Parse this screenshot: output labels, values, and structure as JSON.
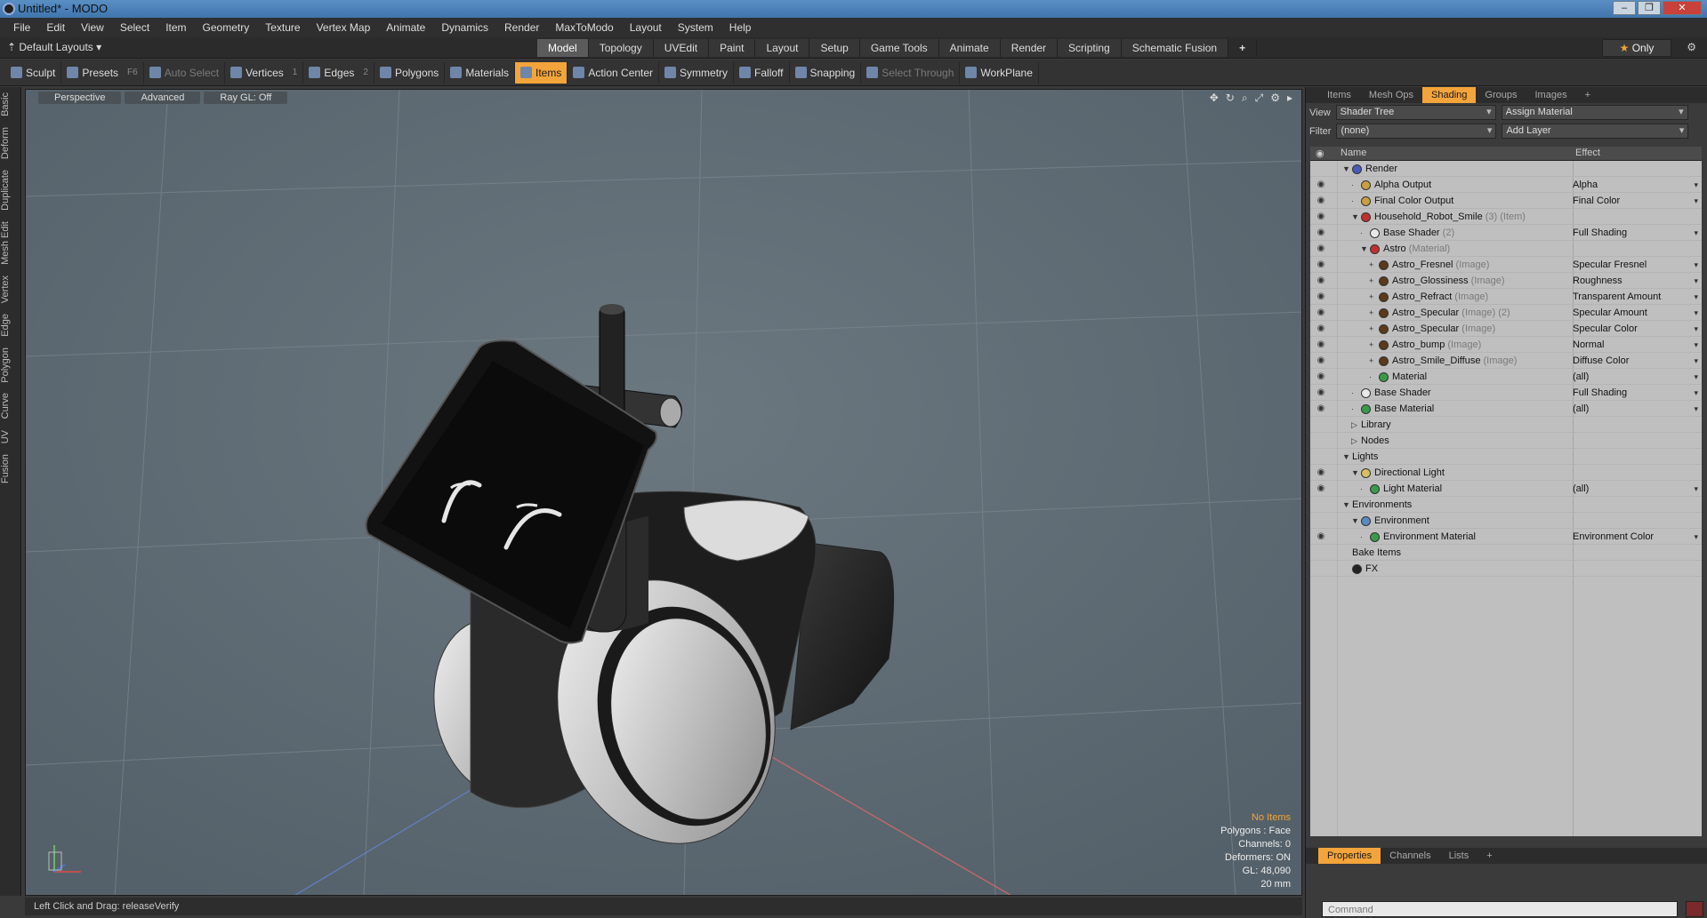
{
  "window": {
    "title": "Untitled* - MODO",
    "controls": [
      "–",
      "❐",
      "✕"
    ]
  },
  "menu": [
    "File",
    "Edit",
    "View",
    "Select",
    "Item",
    "Geometry",
    "Texture",
    "Vertex Map",
    "Animate",
    "Dynamics",
    "Render",
    "MaxToModo",
    "Layout",
    "System",
    "Help"
  ],
  "layout_selector": "Default Layouts",
  "mode_tabs": [
    {
      "label": "Model",
      "active": true
    },
    {
      "label": "Topology"
    },
    {
      "label": "UVEdit"
    },
    {
      "label": "Paint"
    },
    {
      "label": "Layout"
    },
    {
      "label": "Setup"
    },
    {
      "label": "Game Tools"
    },
    {
      "label": "Animate"
    },
    {
      "label": "Render"
    },
    {
      "label": "Scripting"
    },
    {
      "label": "Schematic Fusion"
    }
  ],
  "only_label": "Only",
  "toolbar": [
    {
      "label": "Sculpt",
      "icon": "brush-icon"
    },
    {
      "label": "Presets",
      "key": "F6",
      "icon": "presets-icon"
    },
    {
      "label": "Auto Select",
      "dim": true,
      "icon": "shield-icon"
    },
    {
      "label": "Vertices",
      "key": "1",
      "icon": "vertices-icon"
    },
    {
      "label": "Edges",
      "key": "2",
      "icon": "edges-icon"
    },
    {
      "label": "Polygons",
      "icon": "polygons-icon"
    },
    {
      "label": "Materials",
      "icon": "materials-icon"
    },
    {
      "label": "Items",
      "active": true,
      "icon": "items-icon"
    },
    {
      "label": "Action Center",
      "icon": "action-center-icon"
    },
    {
      "label": "Symmetry",
      "icon": "symmetry-icon"
    },
    {
      "label": "Falloff",
      "icon": "falloff-icon"
    },
    {
      "label": "Snapping",
      "icon": "snapping-icon"
    },
    {
      "label": "Select Through",
      "dim": true,
      "icon": "select-through-icon"
    },
    {
      "label": "WorkPlane",
      "icon": "workplane-icon"
    }
  ],
  "left_tabs": [
    "Basic",
    "Deform",
    "Duplicate",
    "Mesh Edit",
    "Vertex",
    "Edge",
    "Polygon",
    "Curve",
    "UV",
    "Fusion"
  ],
  "viewport": {
    "buttons": [
      "Perspective",
      "Advanced",
      "Ray GL: Off"
    ],
    "stats": {
      "no_items": "No Items",
      "polygons": "Polygons : Face",
      "channels": "Channels: 0",
      "deformers": "Deformers: ON",
      "gl": "GL: 48,090",
      "scale": "20 mm"
    }
  },
  "status": "Left Click and Drag:  releaseVerify",
  "panel_tabs": [
    {
      "label": "Items"
    },
    {
      "label": "Mesh Ops"
    },
    {
      "label": "Shading",
      "active": true
    },
    {
      "label": "Groups"
    },
    {
      "label": "Images"
    },
    {
      "label": "+"
    }
  ],
  "view_label": "View",
  "view_value": "Shader Tree",
  "assign_material": "Assign Material",
  "filter_label": "Filter",
  "filter_value": "(none)",
  "add_layer": "Add Layer",
  "header": {
    "name": "Name",
    "effect": "Effect"
  },
  "tree": [
    {
      "indent": 0,
      "tw": "▼",
      "ico": "#4a5ab8",
      "name": "Render",
      "sub": "",
      "effect": "",
      "eye": false
    },
    {
      "indent": 1,
      "tw": "·",
      "ico": "#c9a040",
      "name": "Alpha Output",
      "sub": "",
      "effect": "Alpha",
      "eye": true
    },
    {
      "indent": 1,
      "tw": "·",
      "ico": "#c9a040",
      "name": "Final Color Output",
      "sub": "",
      "effect": "Final Color",
      "eye": true
    },
    {
      "indent": 1,
      "tw": "▼",
      "ico": "#c03030",
      "name": "Household_Robot_Smile",
      "sub": " (3) (Item)",
      "effect": "",
      "eye": true
    },
    {
      "indent": 2,
      "tw": "·",
      "ico": "#e8e8e8",
      "name": "Base Shader",
      "sub": " (2)",
      "effect": "Full Shading",
      "eye": true
    },
    {
      "indent": 2,
      "tw": "▼",
      "ico": "#c03030",
      "name": "Astro",
      "sub": " (Material)",
      "effect": "",
      "eye": true
    },
    {
      "indent": 3,
      "tw": "+",
      "ico": "#5a3a1a",
      "name": "Astro_Fresnel",
      "sub": " (Image)",
      "effect": "Specular Fresnel",
      "eye": true
    },
    {
      "indent": 3,
      "tw": "+",
      "ico": "#5a3a1a",
      "name": "Astro_Glossiness",
      "sub": " (Image)",
      "effect": "Roughness",
      "eye": true
    },
    {
      "indent": 3,
      "tw": "+",
      "ico": "#5a3a1a",
      "name": "Astro_Refract",
      "sub": " (Image)",
      "effect": "Transparent Amount",
      "eye": true
    },
    {
      "indent": 3,
      "tw": "+",
      "ico": "#5a3a1a",
      "name": "Astro_Specular",
      "sub": " (Image) (2)",
      "effect": "Specular Amount",
      "eye": true
    },
    {
      "indent": 3,
      "tw": "+",
      "ico": "#5a3a1a",
      "name": "Astro_Specular",
      "sub": " (Image)",
      "effect": "Specular Color",
      "eye": true
    },
    {
      "indent": 3,
      "tw": "+",
      "ico": "#5a3a1a",
      "name": "Astro_bump",
      "sub": " (Image)",
      "effect": "Normal",
      "eye": true
    },
    {
      "indent": 3,
      "tw": "+",
      "ico": "#5a3a1a",
      "name": "Astro_Smile_Diffuse",
      "sub": " (Image)",
      "effect": "Diffuse Color",
      "eye": true
    },
    {
      "indent": 3,
      "tw": "·",
      "ico": "#3a9a4a",
      "name": "Material",
      "sub": "",
      "effect": "(all)",
      "eye": true
    },
    {
      "indent": 1,
      "tw": "·",
      "ico": "#e8e8e8",
      "name": "Base Shader",
      "sub": "",
      "effect": "Full Shading",
      "eye": true
    },
    {
      "indent": 1,
      "tw": "·",
      "ico": "#3a9a4a",
      "name": "Base Material",
      "sub": "",
      "effect": "(all)",
      "eye": true
    },
    {
      "indent": 1,
      "tw": "▷",
      "ico": "",
      "name": "Library",
      "sub": "",
      "effect": "",
      "eye": false
    },
    {
      "indent": 1,
      "tw": "▷",
      "ico": "",
      "name": "Nodes",
      "sub": "",
      "effect": "",
      "eye": false
    },
    {
      "indent": 0,
      "tw": "▼",
      "ico": "",
      "name": "Lights",
      "sub": "",
      "effect": "",
      "eye": false
    },
    {
      "indent": 1,
      "tw": "▼",
      "ico": "#d8c060",
      "name": "Directional Light",
      "sub": "",
      "effect": "",
      "eye": true
    },
    {
      "indent": 2,
      "tw": "·",
      "ico": "#3a9a4a",
      "name": "Light Material",
      "sub": "",
      "effect": "(all)",
      "eye": true
    },
    {
      "indent": 0,
      "tw": "▼",
      "ico": "",
      "name": "Environments",
      "sub": "",
      "effect": "",
      "eye": false
    },
    {
      "indent": 1,
      "tw": "▼",
      "ico": "#5a8ac0",
      "name": "Environment",
      "sub": "",
      "effect": "",
      "eye": false
    },
    {
      "indent": 2,
      "tw": "·",
      "ico": "#3a9a4a",
      "name": "Environment Material",
      "sub": "",
      "effect": "Environment Color",
      "eye": true
    },
    {
      "indent": 0,
      "tw": "",
      "ico": "",
      "name": "Bake Items",
      "sub": "",
      "effect": "",
      "eye": false
    },
    {
      "indent": 0,
      "tw": "",
      "ico": "#222222",
      "name": "FX",
      "sub": "",
      "effect": "",
      "eye": false
    }
  ],
  "props_tabs": [
    {
      "label": "Properties",
      "active": true
    },
    {
      "label": "Channels"
    },
    {
      "label": "Lists"
    },
    {
      "label": "+"
    }
  ],
  "command_placeholder": "Command"
}
